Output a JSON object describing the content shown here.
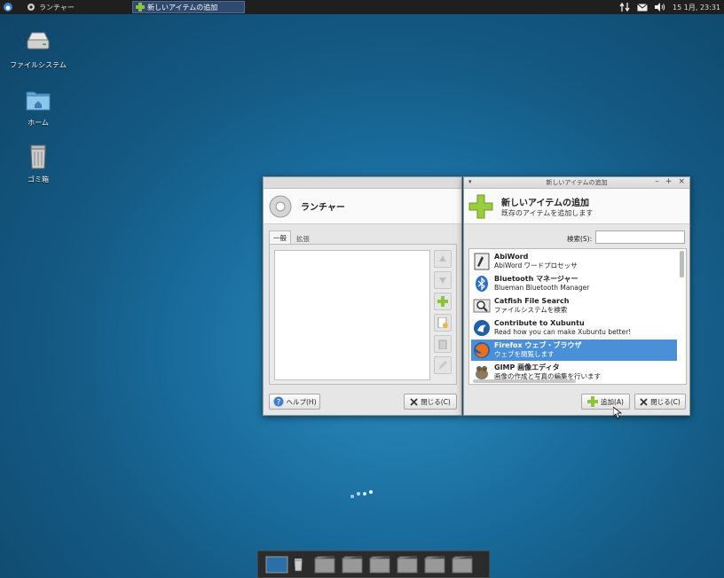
{
  "top_panel": {
    "menu_label": "ランチャー",
    "task_label": "新しいアイテムの追加",
    "clock": "15 1月, 23:31"
  },
  "desktop_icons": [
    {
      "label": "ファイルシステム"
    },
    {
      "label": "ホーム"
    },
    {
      "label": "ゴミ箱"
    }
  ],
  "launcher_window": {
    "title": "ランチャー",
    "tabs": [
      "一般",
      "拡張"
    ],
    "help_label": "ヘルプ(H)",
    "close_label": "閉じる(C)"
  },
  "add_item_window": {
    "title": "新しいアイテムの追加",
    "header_title": "新しいアイテムの追加",
    "header_subtitle": "既存のアイテムを追加します",
    "search_label": "検索(S):",
    "search_value": "",
    "items": [
      {
        "name": "AbiWord",
        "desc": "AbiWord ワードプロセッサ",
        "icon": "abiword-icon"
      },
      {
        "name": "Bluetooth マネージャー",
        "desc": "Blueman Bluetooth Manager",
        "icon": "bluetooth-icon"
      },
      {
        "name": "Catfish File Search",
        "desc": "ファイルシステムを検索",
        "icon": "search-icon"
      },
      {
        "name": "Contribute to Xubuntu",
        "desc": "Read how you can make Xubuntu better!",
        "icon": "xubuntu-icon"
      },
      {
        "name": "Firefox ウェブ・ブラウザ",
        "desc": "ウェブを閲覧します",
        "icon": "firefox-icon",
        "selected": true
      },
      {
        "name": "GIMP 画像エディタ",
        "desc": "画像の作成と写真の編集を行います",
        "icon": "gimp-icon"
      }
    ],
    "add_label": "追加(A)",
    "close_label": "閉じる(C)"
  }
}
